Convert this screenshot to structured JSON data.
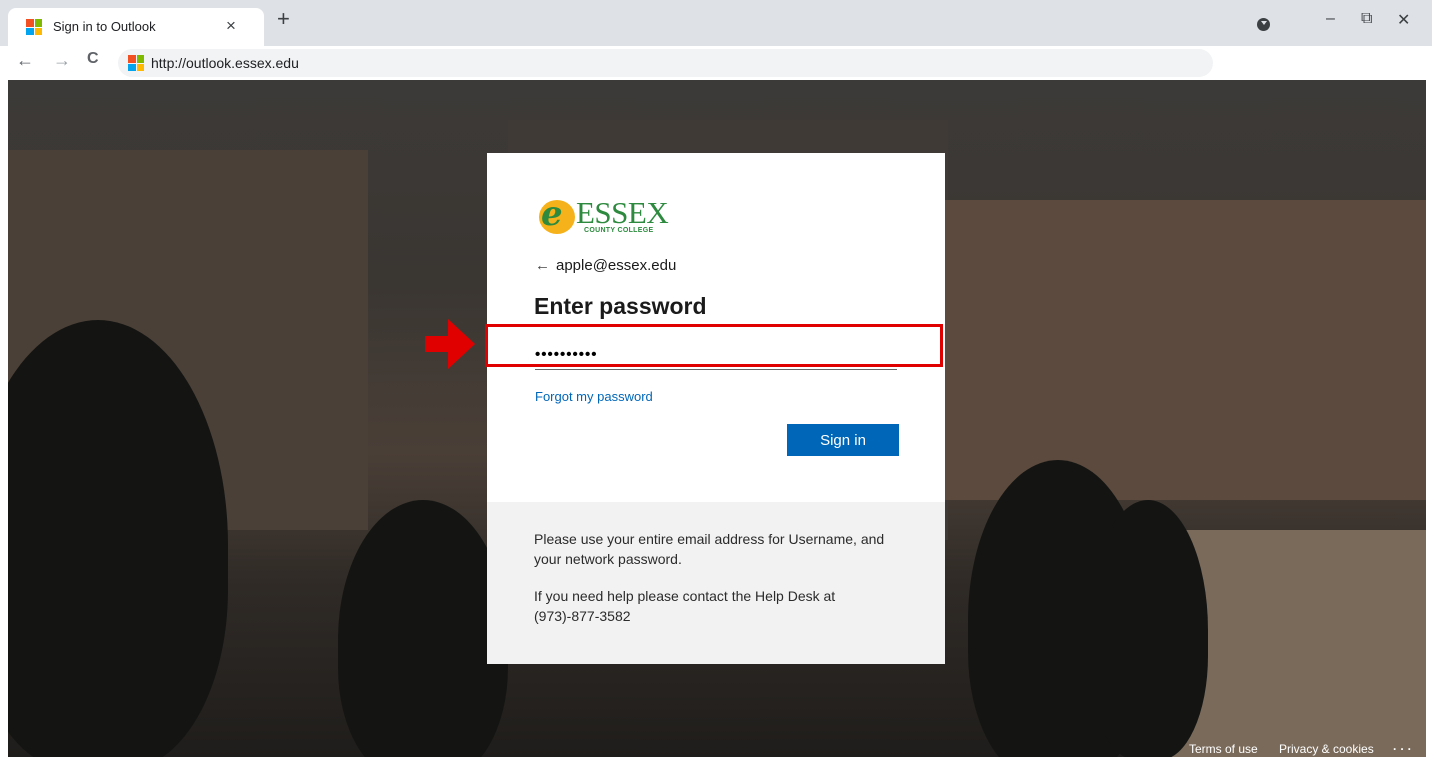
{
  "browser": {
    "tab_title": "Sign in to Outlook",
    "tab_close": "×",
    "new_tab": "+",
    "url": "http://outlook.essex.edu",
    "back": "←",
    "forward": "→",
    "reload": "C",
    "minimize": "–",
    "restore": "⧉",
    "close": "✕",
    "ms_colors": [
      "#f25022",
      "#7fba00",
      "#00a4ef",
      "#ffb900"
    ]
  },
  "signin": {
    "logo_letter": "e",
    "logo_word": "ESSEX",
    "logo_sub": "COUNTY COLLEGE",
    "back_arrow": "←",
    "account": "apple@essex.edu",
    "heading": "Enter password",
    "password_value": "••••••••••",
    "forgot_link": "Forgot my password",
    "signin_button": "Sign in",
    "info_1": "Please use your entire email address for Username, and your network password.",
    "info_2": "If you need help please contact the Help Desk at (973)-877-3582",
    "accent": "#0067b8",
    "brand_green": "#2d8a3e"
  },
  "footer": {
    "terms": "Terms of use",
    "privacy": "Privacy & cookies",
    "more": "· · ·"
  }
}
